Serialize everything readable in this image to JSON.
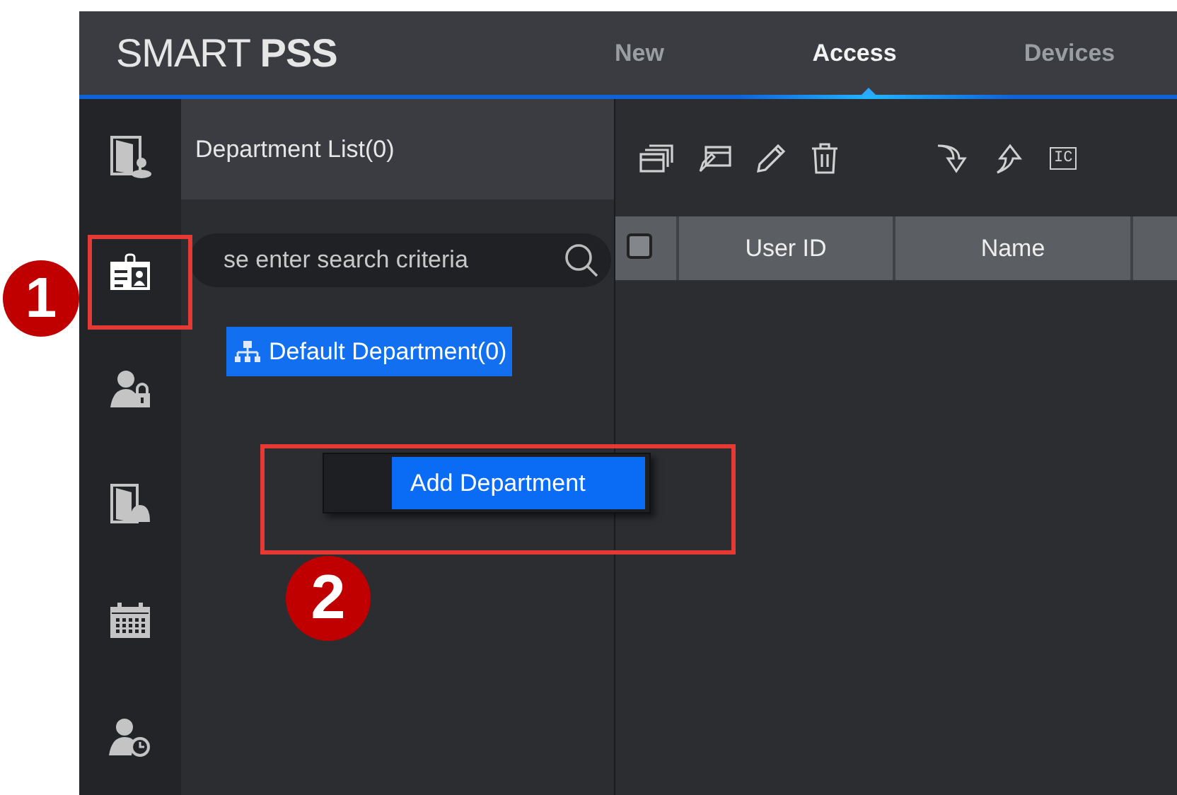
{
  "header": {
    "logo": "SMART **PSS**"
  },
  "tabs": [
    {
      "label": "New",
      "selected": false
    },
    {
      "label": "Access",
      "selected": true
    },
    {
      "label": "Devices",
      "selected": false
    }
  ],
  "sidebar": {
    "items": [
      {
        "kind": "door",
        "selected": false
      },
      {
        "kind": "id-card",
        "selected": true
      },
      {
        "kind": "user-lock",
        "selected": false
      },
      {
        "kind": "door-bell",
        "selected": false
      },
      {
        "kind": "calendar",
        "selected": false
      },
      {
        "kind": "user-clock",
        "selected": false
      }
    ]
  },
  "department_panel": {
    "title": "Department List(0)",
    "search": {
      "placeholder": "se enter search criteria"
    },
    "tree": [
      {
        "label": "Default Department(0)",
        "selected": true
      }
    ]
  },
  "context_menu": {
    "items": [
      {
        "label": "Add Department",
        "selected": true
      }
    ]
  },
  "toolbar": {
    "left": [
      {
        "kind": "cards"
      },
      {
        "kind": "card-edit"
      },
      {
        "kind": "pencil"
      },
      {
        "kind": "trash"
      }
    ],
    "right": [
      {
        "kind": "import"
      },
      {
        "kind": "export"
      },
      {
        "kind": "ic-card",
        "label": "IC"
      }
    ]
  },
  "table": {
    "select_all": {
      "checked": false
    },
    "columns": [
      {
        "label": "User ID"
      },
      {
        "label": "Name"
      }
    ]
  },
  "annotations": [
    {
      "label": "1"
    },
    {
      "label": "2"
    }
  ]
}
